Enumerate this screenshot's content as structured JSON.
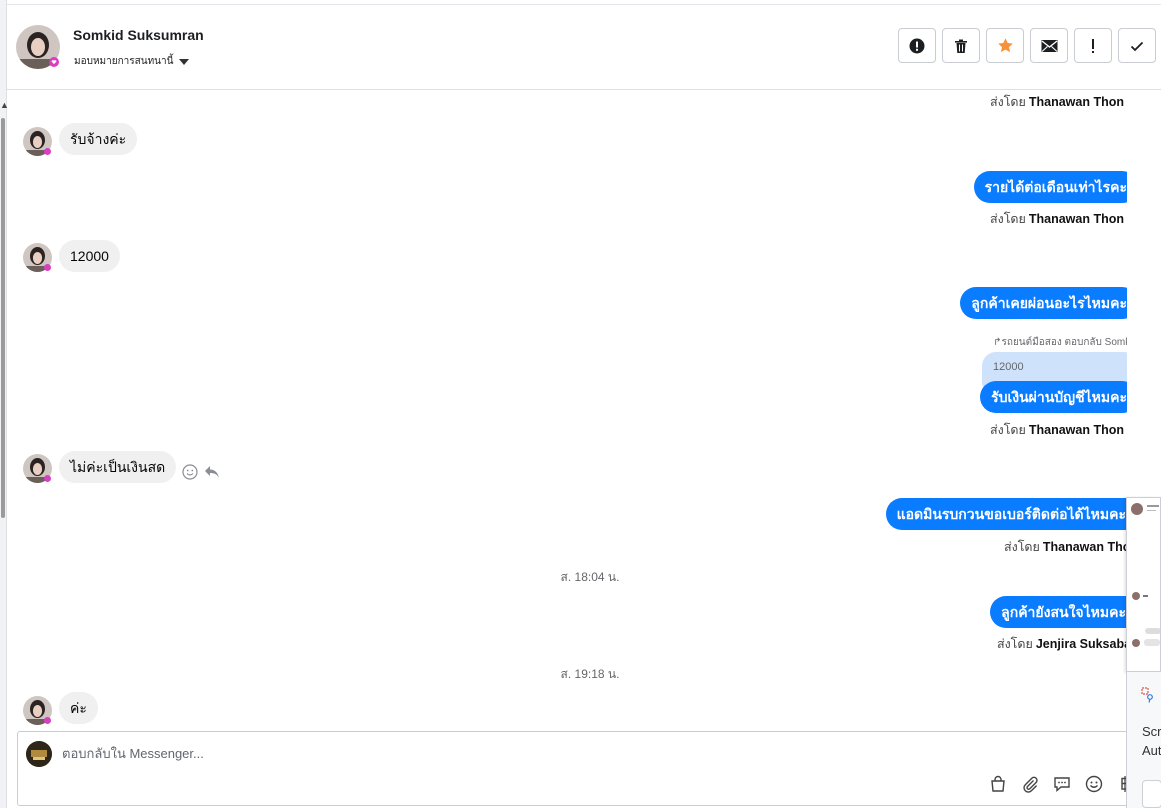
{
  "header": {
    "contact_name": "Somkid Suksumran",
    "assign_label": "มอบหมายการสนทนานี้",
    "actions": [
      {
        "name": "spam-button",
        "icon": "alert-circle-icon"
      },
      {
        "name": "delete-button",
        "icon": "trash-icon"
      },
      {
        "name": "star-button",
        "icon": "star-icon"
      },
      {
        "name": "mark-unread-button",
        "icon": "envelope-icon"
      },
      {
        "name": "follow-up-button",
        "icon": "exclamation-icon"
      },
      {
        "name": "mark-done-button",
        "icon": "check-icon"
      }
    ]
  },
  "thread": {
    "sent_by_prefix": "ส่งโดย",
    "top_sent_by": "Thanawan Thon",
    "msg1": "รับจ้างค่ะ",
    "msg2": "รายได้ต่อเดือนเท่าไรคะ",
    "msg2_sender": "Thanawan Thon",
    "msg3": "12000",
    "msg4": "ลูกค้าเคยผ่อนอะไรไหมคะ",
    "reply_meta": "รถยนต์มือสอง ตอบกลับ Somkid",
    "reply_quote": "12000",
    "msg5": "รับเงินผ่านบัญชีไหมคะ",
    "msg5_sender": "Thanawan Thon",
    "msg6": "ไม่ค่ะเป็นเงินสด",
    "msg7": "แอดมินรบกวนขอเบอร์ติดต่อได้ไหมคะ",
    "msg7_sender": "Thanawan Thon",
    "time1": "ส. 18:04 น.",
    "msg8": "ลูกค้ายังสนใจไหมคะ",
    "msg8_sender": "Jenjira Suksabay",
    "time2": "ส. 19:18 น.",
    "msg9": "ค่ะ"
  },
  "composer": {
    "placeholder": "ตอบกลับใน Messenger...",
    "tools": [
      "shopping-bag-icon",
      "paperclip-icon",
      "saved-reply-icon",
      "emoji-icon",
      "baht-payment-icon"
    ]
  },
  "side_panel": {
    "line1": "Scr",
    "line2": "Aut"
  },
  "colors": {
    "outgoing_bubble": "#0a7cff",
    "incoming_bubble": "#f0f0f0",
    "star": "#f7923b"
  }
}
